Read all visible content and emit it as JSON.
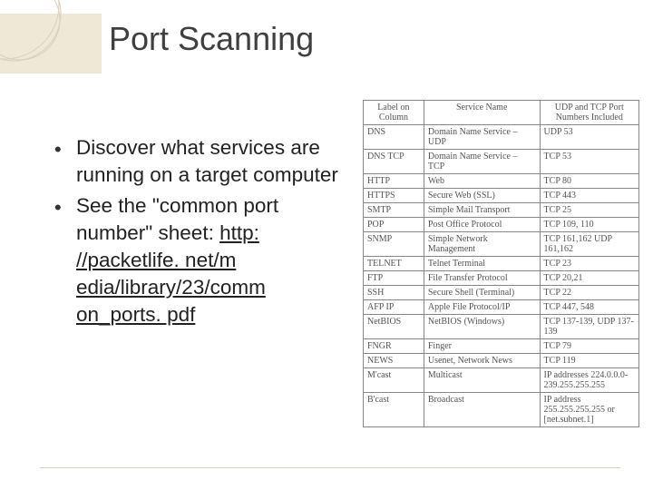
{
  "title": "Port Scanning",
  "bullets": [
    {
      "text": "Discover what services are running on a target computer"
    },
    {
      "text": "See the \"common port number\" sheet: ",
      "link": "http: //packetlife. net/m edia/library/23/comm on_ports. pdf"
    }
  ],
  "table": {
    "headers": [
      "Label on Column",
      "Service Name",
      "UDP and TCP Port Numbers Included"
    ],
    "rows": [
      [
        "DNS",
        "Domain Name Service – UDP",
        "UDP 53"
      ],
      [
        "DNS TCP",
        "Domain Name Service – TCP",
        "TCP 53"
      ],
      [
        "HTTP",
        "Web",
        "TCP 80"
      ],
      [
        "HTTPS",
        "Secure Web (SSL)",
        "TCP 443"
      ],
      [
        "SMTP",
        "Simple Mail Transport",
        "TCP 25"
      ],
      [
        "POP",
        "Post Office Protocol",
        "TCP 109, 110"
      ],
      [
        "SNMP",
        "Simple Network Management",
        "TCP 161,162 UDP 161,162"
      ],
      [
        "TELNET",
        "Telnet Terminal",
        "TCP 23"
      ],
      [
        "FTP",
        "File Transfer Protocol",
        "TCP 20,21"
      ],
      [
        "SSH",
        "Secure Shell (Terminal)",
        "TCP 22"
      ],
      [
        "AFP IP",
        "Apple File Protocol/IP",
        "TCP 447, 548"
      ],
      [
        "NetBIOS",
        "NetBIOS (Windows)",
        "TCP 137-139, UDP 137-139"
      ],
      [
        "FNGR",
        "Finger",
        "TCP 79"
      ],
      [
        "NEWS",
        "Usenet, Network News",
        "TCP 119"
      ],
      [
        "M'cast",
        "Multicast",
        "IP addresses 224.0.0.0-239.255.255.255"
      ],
      [
        "B'cast",
        "Broadcast",
        "IP address 255.255.255.255 or [net.subnet.1]"
      ]
    ]
  }
}
